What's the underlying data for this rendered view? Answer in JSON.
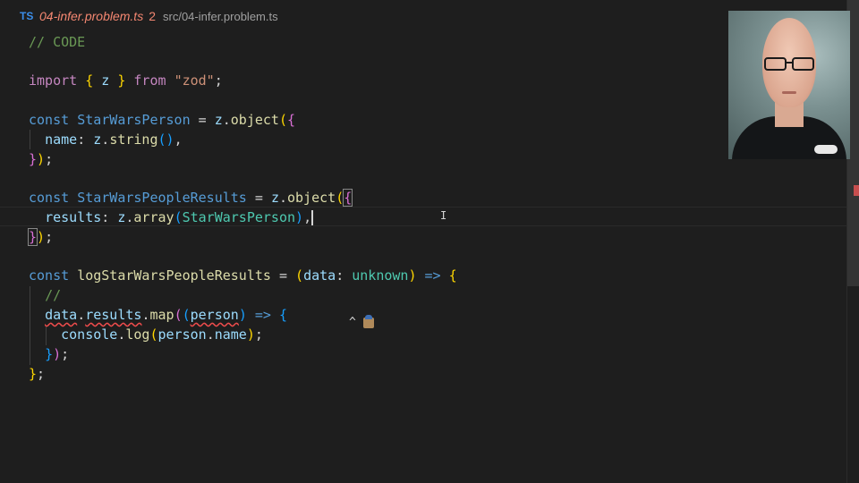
{
  "tab": {
    "icon": "TS",
    "filename": "04-infer.problem.ts",
    "problem_count": "2",
    "path": "src/04-infer.problem.ts"
  },
  "code": {
    "comment_code": "// CODE",
    "import_kw": "import",
    "import_name": "z",
    "from_kw": "from",
    "module": "\"zod\"",
    "const_kw": "const",
    "person_schema": "StarWarsPerson",
    "results_schema": "StarWarsPeopleResults",
    "log_fn": "logStarWarsPeopleResults",
    "z": "z",
    "object_fn": "object",
    "string_fn": "string",
    "array_fn": "array",
    "name_prop": "name",
    "results_prop": "results",
    "data_param": "data",
    "unknown_type": "unknown",
    "arrow": "=>",
    "empty_comment": "//",
    "results_access": "results",
    "map_fn": "map",
    "person_param": "person",
    "console": "console",
    "log": "log",
    "name_access": "name"
  },
  "hint": {
    "caret": "^"
  },
  "icons": {
    "ts": "typescript-icon",
    "hint": "detective-emoji-icon"
  },
  "colors": {
    "background": "#1e1e1e",
    "error": "#f48771",
    "keyword": "#569cd6",
    "type": "#4ec9b0",
    "variable": "#9cdcfe",
    "function": "#dcdcaa",
    "string": "#ce9178",
    "comment": "#6a9955"
  }
}
